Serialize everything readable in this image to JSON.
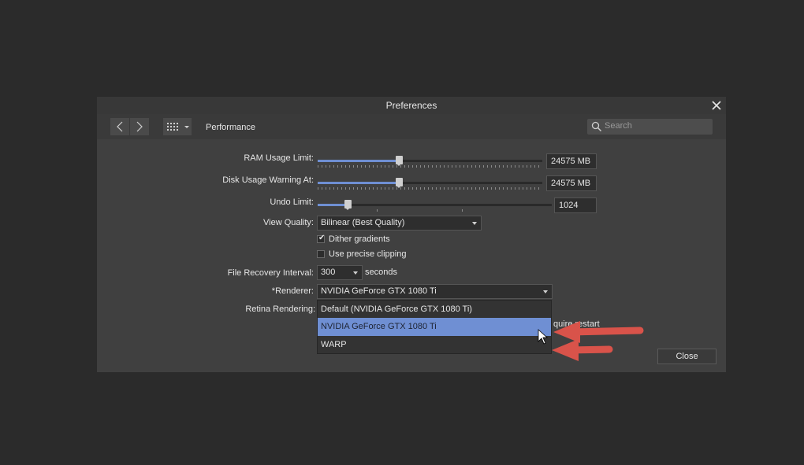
{
  "dialog": {
    "title": "Preferences"
  },
  "toolbar": {
    "page_label": "Performance",
    "search_placeholder": "Search"
  },
  "settings": {
    "ram_label": "RAM Usage Limit:",
    "ram_value": "24575 MB",
    "ram_fraction": 0.36,
    "disk_label": "Disk Usage Warning At:",
    "disk_value": "24575 MB",
    "disk_fraction": 0.36,
    "undo_label": "Undo Limit:",
    "undo_value": "1024",
    "view_quality_label": "View Quality:",
    "view_quality_value": "Bilinear (Best Quality)",
    "dither_label": "Dither gradients",
    "dither_checked": true,
    "precise_clipping_label": "Use precise clipping",
    "precise_clipping_checked": false,
    "recovery_label": "File Recovery Interval:",
    "recovery_value": "300",
    "recovery_unit": "seconds",
    "renderer_label": "*Renderer:",
    "renderer_value": "NVIDIA GeForce GTX 1080 Ti",
    "retina_label": "Retina Rendering:",
    "restart_note_fragment": "quire restart"
  },
  "renderer_menu": {
    "options": [
      "Default (NVIDIA GeForce GTX 1080 Ti)",
      "NVIDIA GeForce GTX 1080 Ti",
      "WARP"
    ],
    "selected_index": 1
  },
  "footer": {
    "close_label": "Close"
  },
  "colors": {
    "accent": "#6f8fd3",
    "arrow": "#d9534a",
    "background": "#2b2b2b",
    "dialog": "#404040"
  }
}
